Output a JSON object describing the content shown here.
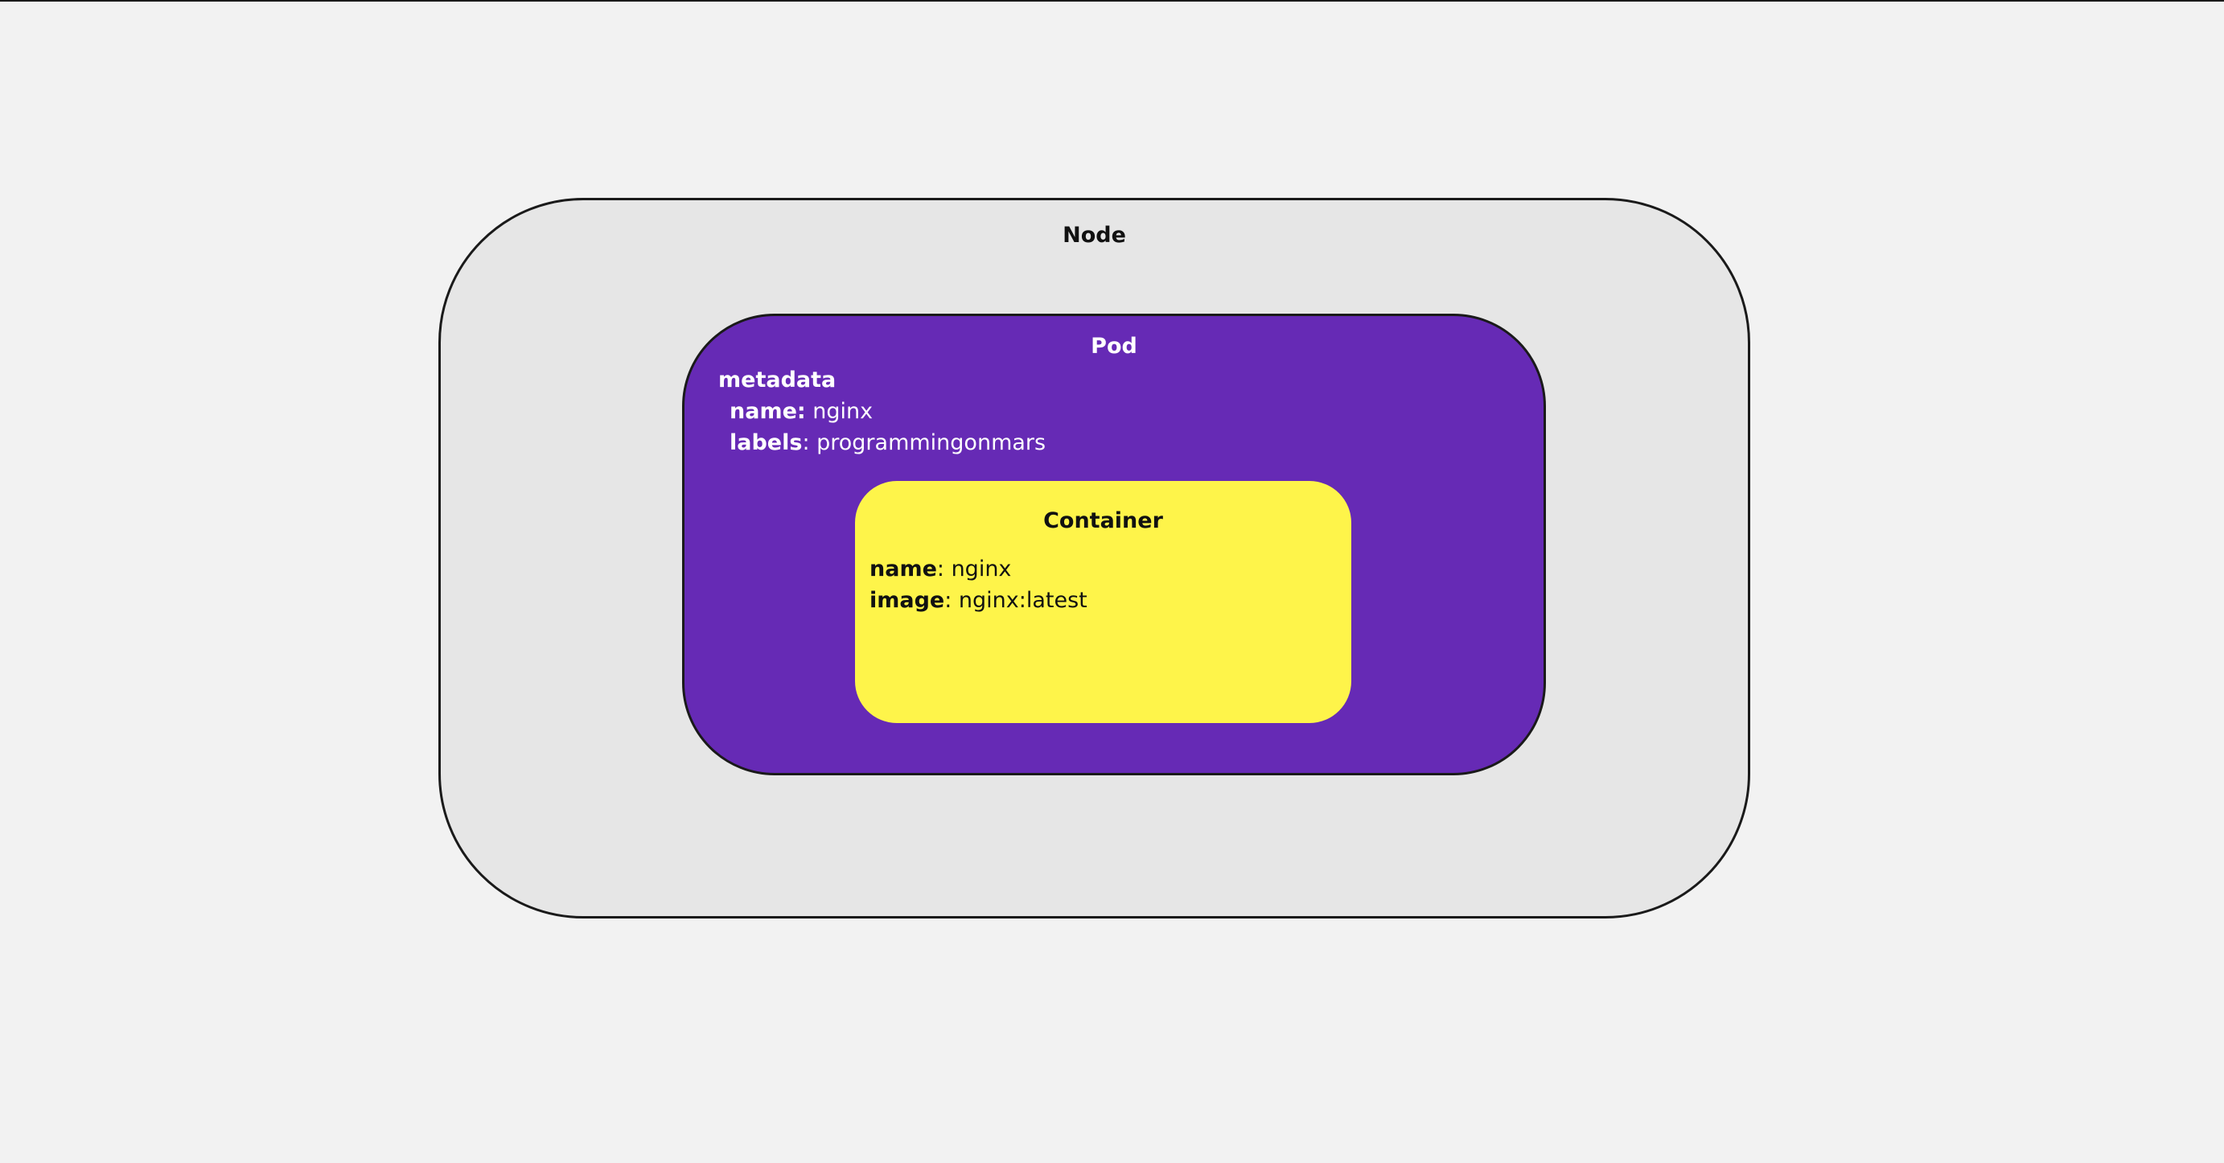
{
  "node": {
    "title": "Node"
  },
  "pod": {
    "title": "Pod",
    "metadata_label": "metadata",
    "name_key": "name:",
    "name_value": " nginx",
    "labels_key": "labels",
    "labels_value": ": programmingonmars"
  },
  "container": {
    "title": "Container",
    "name_key": "name",
    "name_value": ": nginx",
    "image_key": "image",
    "image_value": ": nginx:latest"
  },
  "colors": {
    "background": "#f2f2f2",
    "node_fill": "#e6e6e6",
    "pod_fill": "#662ab5",
    "container_fill": "#fef44a",
    "outline": "#1a1a1a"
  }
}
